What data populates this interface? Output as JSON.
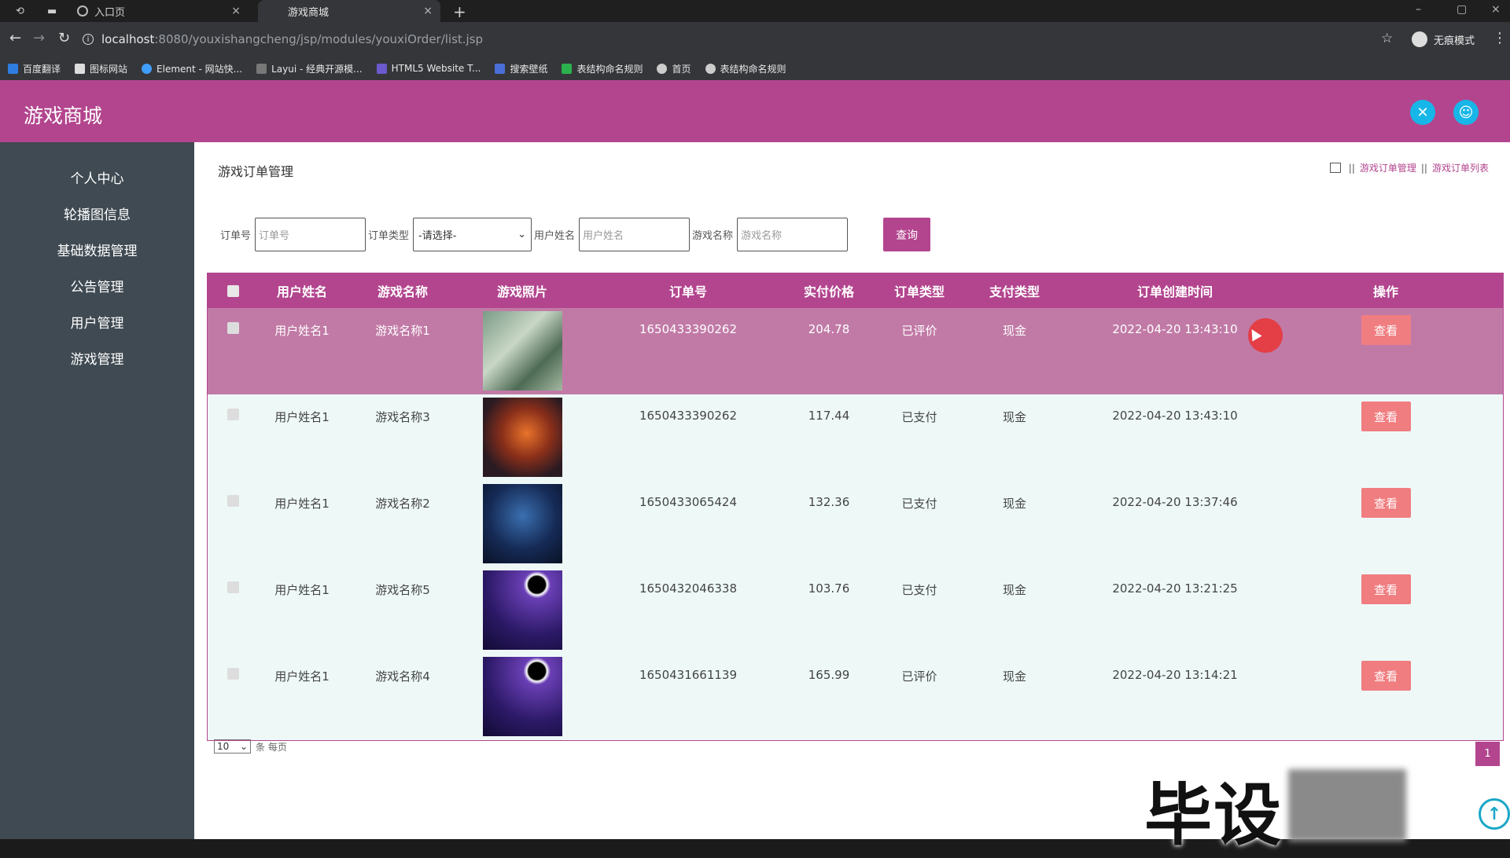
{
  "browser": {
    "tabs": [
      {
        "label": "入口页",
        "active": false
      },
      {
        "label": "游戏商城",
        "active": true
      }
    ],
    "url_host": "localhost",
    "url_path": ":8080/youxishangcheng/jsp/modules/youxiOrder/list.jsp",
    "incognito_label": "无痕模式",
    "bookmarks": [
      "百度翻译",
      "图标网站",
      "Element - 网站快...",
      "Layui - 经典开源模...",
      "HTML5 Website T...",
      "搜索壁纸",
      "表结构命名规则",
      "首页",
      "表结构命名规则"
    ]
  },
  "app": {
    "brand": "游戏商城",
    "sidebar": [
      "个人中心",
      "轮播图信息",
      "基础数据管理",
      "公告管理",
      "用户管理",
      "游戏管理"
    ],
    "page_title": "游戏订单管理",
    "breadcrumb": [
      "游戏订单管理",
      "游戏订单列表"
    ],
    "filters": {
      "order_no_label": "订单号",
      "order_no_placeholder": "订单号",
      "order_type_label": "订单类型",
      "order_type_value": "-请选择-",
      "user_label": "用户姓名",
      "user_placeholder": "用户姓名",
      "game_label": "游戏名称",
      "game_placeholder": "游戏名称",
      "query_label": "查询"
    },
    "table": {
      "headers": [
        "用户姓名",
        "游戏名称",
        "游戏照片",
        "订单号",
        "实付价格",
        "订单类型",
        "支付类型",
        "订单创建时间",
        "操作"
      ],
      "rows": [
        {
          "user": "用户姓名1",
          "game": "游戏名称1",
          "order": "1650433390262",
          "price": "204.78",
          "otype": "已评价",
          "ptype": "现金",
          "time": "2022-04-20 13:43:10",
          "action": "查看"
        },
        {
          "user": "用户姓名1",
          "game": "游戏名称3",
          "order": "1650433390262",
          "price": "117.44",
          "otype": "已支付",
          "ptype": "现金",
          "time": "2022-04-20 13:43:10",
          "action": "查看"
        },
        {
          "user": "用户姓名1",
          "game": "游戏名称2",
          "order": "1650433065424",
          "price": "132.36",
          "otype": "已支付",
          "ptype": "现金",
          "time": "2022-04-20 13:37:46",
          "action": "查看"
        },
        {
          "user": "用户姓名1",
          "game": "游戏名称5",
          "order": "1650432046338",
          "price": "103.76",
          "otype": "已支付",
          "ptype": "现金",
          "time": "2022-04-20 13:21:25",
          "action": "查看"
        },
        {
          "user": "用户姓名1",
          "game": "游戏名称4",
          "order": "1650431661139",
          "price": "165.99",
          "otype": "已评价",
          "ptype": "现金",
          "time": "2022-04-20 13:14:21",
          "action": "查看"
        }
      ]
    },
    "pager": {
      "size": "10",
      "size_label": "条 每页",
      "page": "1"
    },
    "watermark": "毕设"
  },
  "colors": {
    "accent": "#b3458e",
    "sidebar": "#3f4a52",
    "view_button": "#f07d80",
    "highlight_row": "#c17aa6"
  }
}
